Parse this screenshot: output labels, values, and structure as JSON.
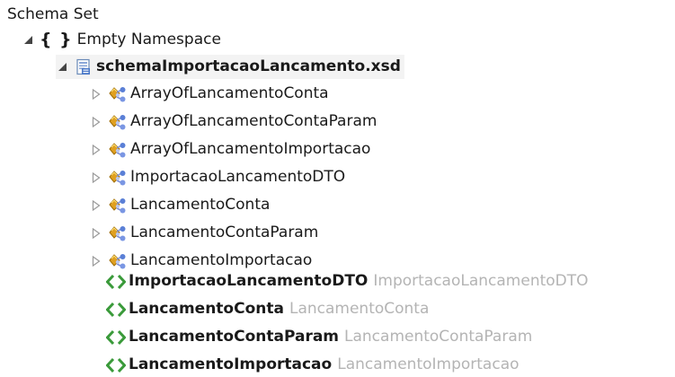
{
  "tree": {
    "root_label": "Schema Set",
    "namespace": {
      "braces": "{ }",
      "label": "Empty Namespace"
    },
    "file": {
      "label": "schemaImportacaoLancamento.xsd"
    },
    "complex_types": [
      {
        "label": "ArrayOfLancamentoConta"
      },
      {
        "label": "ArrayOfLancamentoContaParam"
      },
      {
        "label": "ArrayOfLancamentoImportacao"
      },
      {
        "label": "ImportacaoLancamentoDTO"
      },
      {
        "label": "LancamentoConta"
      },
      {
        "label": "LancamentoContaParam"
      },
      {
        "label": "LancamentoImportacao"
      }
    ],
    "elements": [
      {
        "label": "ImportacaoLancamentoDTO",
        "type": "ImportacaoLancamentoDTO"
      },
      {
        "label": "LancamentoConta",
        "type": "LancamentoConta"
      },
      {
        "label": "LancamentoContaParam",
        "type": "LancamentoContaParam"
      },
      {
        "label": "LancamentoImportacao",
        "type": "LancamentoImportacao"
      }
    ]
  },
  "colors": {
    "element_icon": "#3a9a3a",
    "type_icon_gold": "#e0a020",
    "type_icon_blue": "#5a7fd6",
    "type_reference_text": "#b4b4b4"
  },
  "icons": {
    "expanded": "expanded-triangle-icon",
    "collapsed": "collapsed-triangle-icon",
    "file": "xsd-file-icon",
    "complex_type": "complex-type-icon",
    "element": "element-icon"
  }
}
